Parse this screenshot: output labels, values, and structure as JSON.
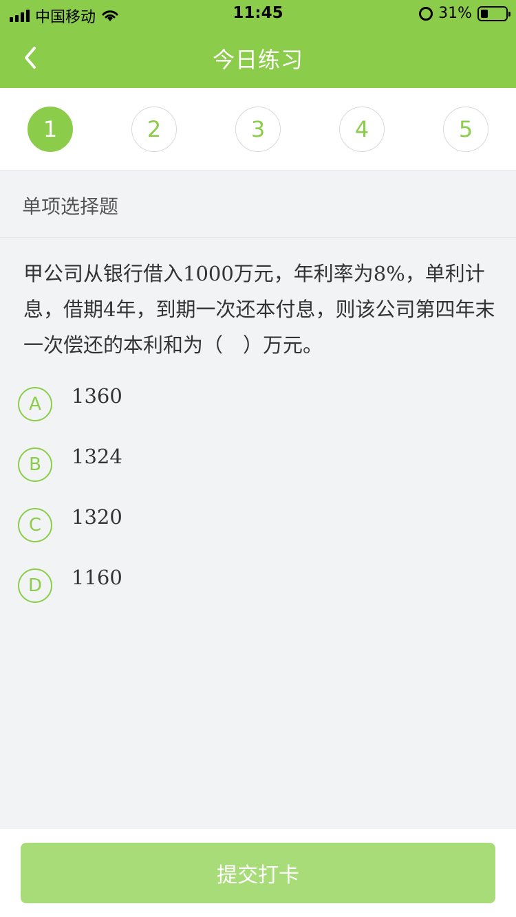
{
  "status_bar": {
    "carrier": "中国移动",
    "time": "11:45",
    "battery": "31%",
    "icons": [
      "signal-icon",
      "wifi-icon",
      "alarm-icon",
      "battery-icon"
    ]
  },
  "nav": {
    "back_icon": "chevron-left-icon",
    "title": "今日练习"
  },
  "steps": [
    {
      "label": "1",
      "active": true
    },
    {
      "label": "2",
      "active": false
    },
    {
      "label": "3",
      "active": false
    },
    {
      "label": "4",
      "active": false
    },
    {
      "label": "5",
      "active": false
    }
  ],
  "question": {
    "type": "单项选择题",
    "text": "甲公司从银行借入1000万元，年利率为8%，单利计息，借期4年，到期一次还本付息，则该公司第四年末一次偿还的本利和为（　）万元。",
    "options": [
      {
        "letter": "A",
        "text": "1360"
      },
      {
        "letter": "B",
        "text": "1324"
      },
      {
        "letter": "C",
        "text": "1320"
      },
      {
        "letter": "D",
        "text": "1160"
      }
    ]
  },
  "footer": {
    "submit_label": "提交打卡"
  },
  "colors": {
    "accent": "#8bcd4a",
    "button_disabled": "#a7dc78",
    "background": "#f2f3f5"
  }
}
